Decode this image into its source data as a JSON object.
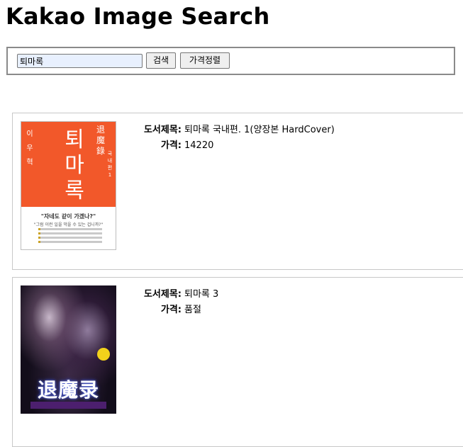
{
  "header": {
    "title": "Kakao Image Search"
  },
  "search": {
    "value": "퇴마록",
    "search_button_label": "검색",
    "sort_button_label": "가격정렬"
  },
  "results": [
    {
      "title_label": "도서제목:",
      "title": "퇴마록 국내편. 1(양장본 HardCover)",
      "price_label": "가격:",
      "price": "14220",
      "cover": {
        "author": "이우혁",
        "title": "퇴마록",
        "hanja": "退魔錄",
        "volume": "국내편 1",
        "quote": "\"자네도 같이 가겠나?\"",
        "subquote": "\"그럼 이런 일을 막을 수 있는 겁니까?\"",
        "color": "#f2582a"
      }
    },
    {
      "title_label": "도서제목:",
      "title": "퇴마록 3",
      "price_label": "가격:",
      "price": "품절",
      "cover": {
        "title": "退魔录",
        "color": "#0d0a12"
      }
    }
  ]
}
